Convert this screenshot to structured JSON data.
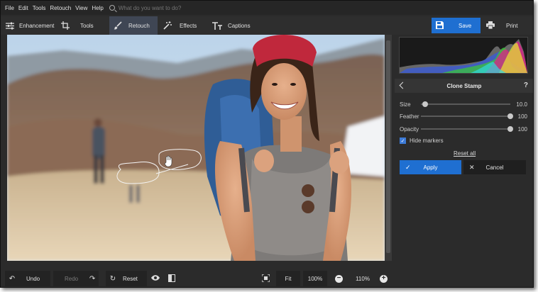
{
  "menu": [
    "File",
    "Edit",
    "Tools",
    "Retouch",
    "View",
    "Help"
  ],
  "search": {
    "placeholder": "What do you want to do?"
  },
  "tabs": [
    {
      "label": "Enhancement",
      "icon": "sliders-icon"
    },
    {
      "label": "Tools",
      "icon": "crop-icon"
    },
    {
      "label": "Retouch",
      "icon": "brush-icon"
    },
    {
      "label": "Effects",
      "icon": "magic-wand-icon"
    },
    {
      "label": "Captions",
      "icon": "text-icon"
    }
  ],
  "actions": {
    "save": "Save",
    "print": "Print"
  },
  "panel": {
    "title": "Clone Stamp",
    "help": "?",
    "size": {
      "label": "Size",
      "value": "10.0",
      "level": 0.05
    },
    "feather": {
      "label": "Feather",
      "value": "100",
      "level": 1.0
    },
    "opacity": {
      "label": "Opacity",
      "value": "100",
      "level": 1.0
    },
    "hide_markers": {
      "label": "Hide markers",
      "checked": true
    },
    "reset_all": "Reset all",
    "apply": "Apply",
    "cancel": "Cancel"
  },
  "bottom": {
    "undo": "Undo",
    "redo": "Redo",
    "reset": "Reset",
    "fit": "Fit",
    "zoom_100": "100%",
    "zoom_current": "110%"
  },
  "colors": {
    "accent": "#1f6fd1",
    "background": "#2b2b2b",
    "tab_active": "#3f4654"
  }
}
